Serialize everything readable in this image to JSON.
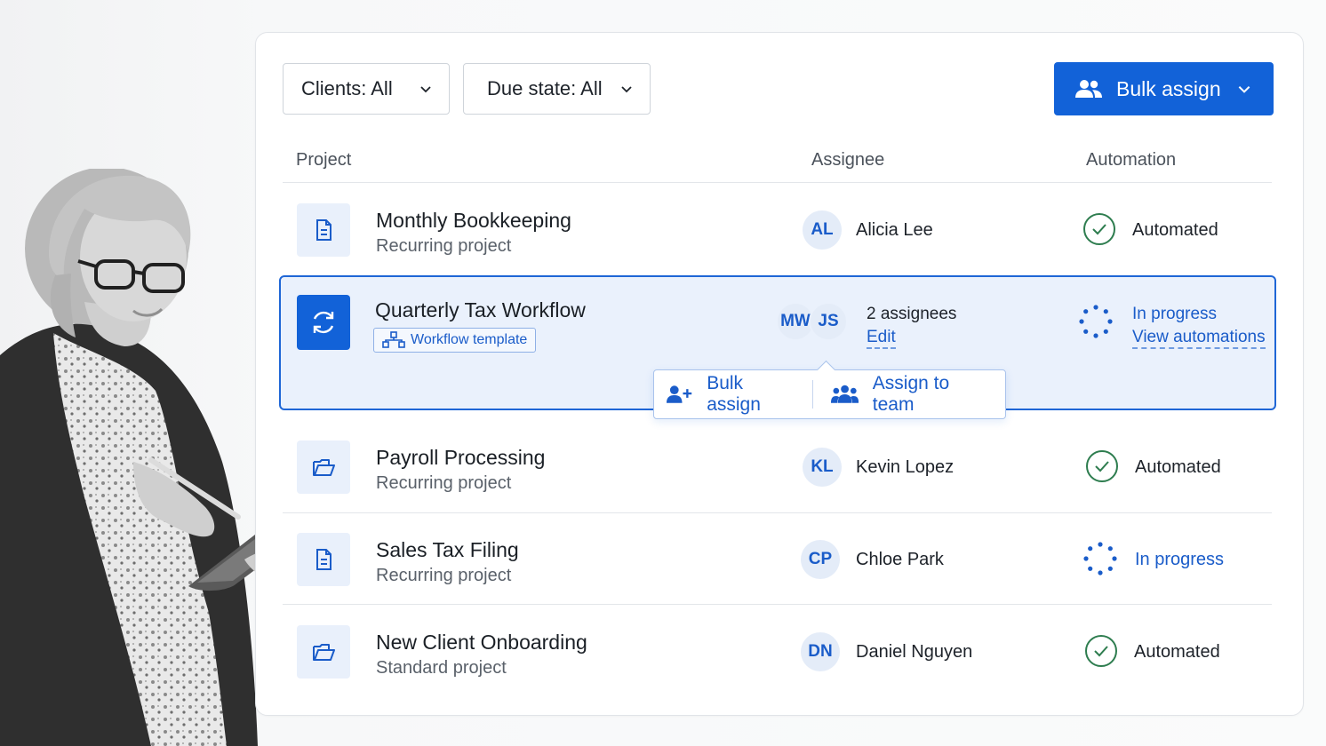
{
  "filters": {
    "clients_label": "Clients: All",
    "due_state_label": "Due state: All"
  },
  "toolbar": {
    "bulk_assign_label": "Bulk assign"
  },
  "columns": {
    "project": "Project",
    "assignee": "Assignee",
    "automation": "Automation"
  },
  "rows": [
    {
      "title": "Monthly Bookkeeping",
      "subtitle": "Recurring project",
      "icon": "document-icon",
      "initials": "AL",
      "assignee": "Alicia Lee",
      "automation": "Automated",
      "status": "done"
    },
    {
      "title": "Quarterly Tax Workflow",
      "badge": "Workflow template",
      "icon": "sync-icon",
      "initials": [
        "MW",
        "JS"
      ],
      "assignee": "2 assignees",
      "edit_label": "Edit",
      "automation": "In progress",
      "view_label": "View automations",
      "status": "progress",
      "selected": true
    },
    {
      "title": "Payroll Processing",
      "subtitle": "Recurring project",
      "icon": "folder-icon",
      "initials": "KL",
      "assignee": "Kevin Lopez",
      "automation": "Automated",
      "status": "done"
    },
    {
      "title": "Sales Tax Filing",
      "subtitle": "Recurring project",
      "icon": "document-icon",
      "initials": "CP",
      "assignee": "Chloe Park",
      "automation": "In progress",
      "status": "progress"
    },
    {
      "title": "New Client Onboarding",
      "subtitle": "Standard project",
      "icon": "folder-icon",
      "initials": "DN",
      "assignee": "Daniel Nguyen",
      "automation": "Automated",
      "status": "done"
    }
  ],
  "popover": {
    "bulk_assign": "Bulk assign",
    "assign_team": "Assign to team"
  },
  "colors": {
    "accent": "#1262d8",
    "success": "#2e7d4f",
    "selected_bg": "#eaf1fc"
  }
}
